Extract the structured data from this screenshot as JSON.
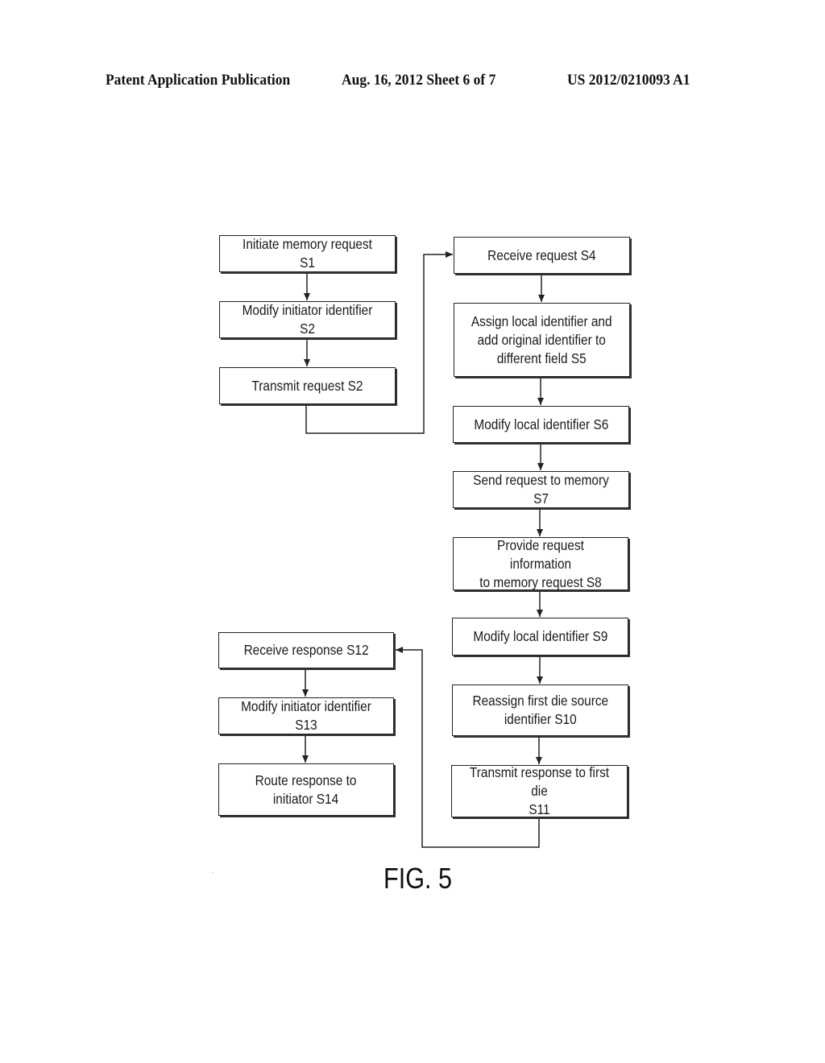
{
  "header": {
    "publication": "Patent Application Publication",
    "date_sheet": "Aug. 16, 2012  Sheet 6 of 7",
    "number": "US 2012/0210093 A1"
  },
  "figure_label": "FIG. 5",
  "steps": [
    {
      "id": "S1",
      "text": "Initiate memory request S1"
    },
    {
      "id": "S2",
      "text": "Modify initiator identifier S2"
    },
    {
      "id": "S2b",
      "text": "Transmit request S2"
    },
    {
      "id": "S4",
      "text": "Receive request S4"
    },
    {
      "id": "S5",
      "text": "Assign local identifier and\nadd original identifier to\ndifferent field S5"
    },
    {
      "id": "S6",
      "text": "Modify local identifier S6"
    },
    {
      "id": "S7",
      "text": "Send request to memory S7"
    },
    {
      "id": "S8",
      "text": "Provide request information\nto memory request S8"
    },
    {
      "id": "S9",
      "text": "Modify local identifier S9"
    },
    {
      "id": "S10",
      "text": "Reassign first die source\nidentifier S10"
    },
    {
      "id": "S11",
      "text": "Transmit response to first die\nS11"
    },
    {
      "id": "S12",
      "text": "Receive response S12"
    },
    {
      "id": "S13",
      "text": "Modify initiator identifier S13"
    },
    {
      "id": "S14",
      "text": "Route response to\ninitiator S14"
    }
  ],
  "flow": [
    [
      "S1",
      "S2"
    ],
    [
      "S2",
      "S2b"
    ],
    [
      "S2b",
      "S4"
    ],
    [
      "S4",
      "S5"
    ],
    [
      "S5",
      "S6"
    ],
    [
      "S6",
      "S7"
    ],
    [
      "S7",
      "S8"
    ],
    [
      "S8",
      "S9"
    ],
    [
      "S9",
      "S10"
    ],
    [
      "S10",
      "S11"
    ],
    [
      "S11",
      "S12"
    ],
    [
      "S12",
      "S13"
    ],
    [
      "S13",
      "S14"
    ]
  ]
}
